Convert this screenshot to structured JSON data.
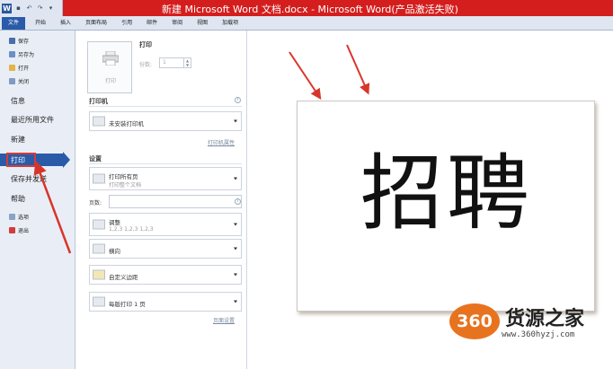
{
  "window": {
    "title": "新建 Microsoft Word 文档.docx - Microsoft Word(产品激活失败)",
    "app_icon": "W"
  },
  "quick_access": [
    "save-icon",
    "undo-icon",
    "redo-icon",
    "customize-icon"
  ],
  "tabs": [
    "文件",
    "开始",
    "插入",
    "页面布局",
    "引用",
    "邮件",
    "审阅",
    "视图",
    "加载项"
  ],
  "nav": {
    "save": "保存",
    "save_as": "另存为",
    "open": "打开",
    "close": "关闭",
    "info": "信息",
    "recent": "最近所用文件",
    "new": "新建",
    "print": "打印",
    "save_send": "保存并发送",
    "help": "帮助",
    "options": "选项",
    "exit": "退出"
  },
  "print_panel": {
    "print_button": "打印",
    "title": "打印",
    "copies_label": "份数:",
    "copies_value": "1",
    "printer_section": "打印机",
    "printer_name": "未安装打印机",
    "printer_props": "打印机属性",
    "settings_section": "设置",
    "print_all_title": "打印所有页",
    "print_all_sub": "打印整个文档",
    "pages_label": "页数:",
    "pages_value": "",
    "collate_title": "调整",
    "collate_sub": "1,2,3   1,2,3   1,2,3",
    "orientation": "横向",
    "margins": "自定义边距",
    "per_sheet": "每版打印 1 页",
    "page_setup": "页面设置"
  },
  "preview": {
    "content": "招聘"
  },
  "watermark": {
    "logo": "360",
    "name": "货源之家",
    "url": "www.360hyzj.com"
  },
  "colors": {
    "titlebar": "#d41e1e",
    "file_tab": "#2a5ba8",
    "annotation_arrow": "#d8352a"
  }
}
